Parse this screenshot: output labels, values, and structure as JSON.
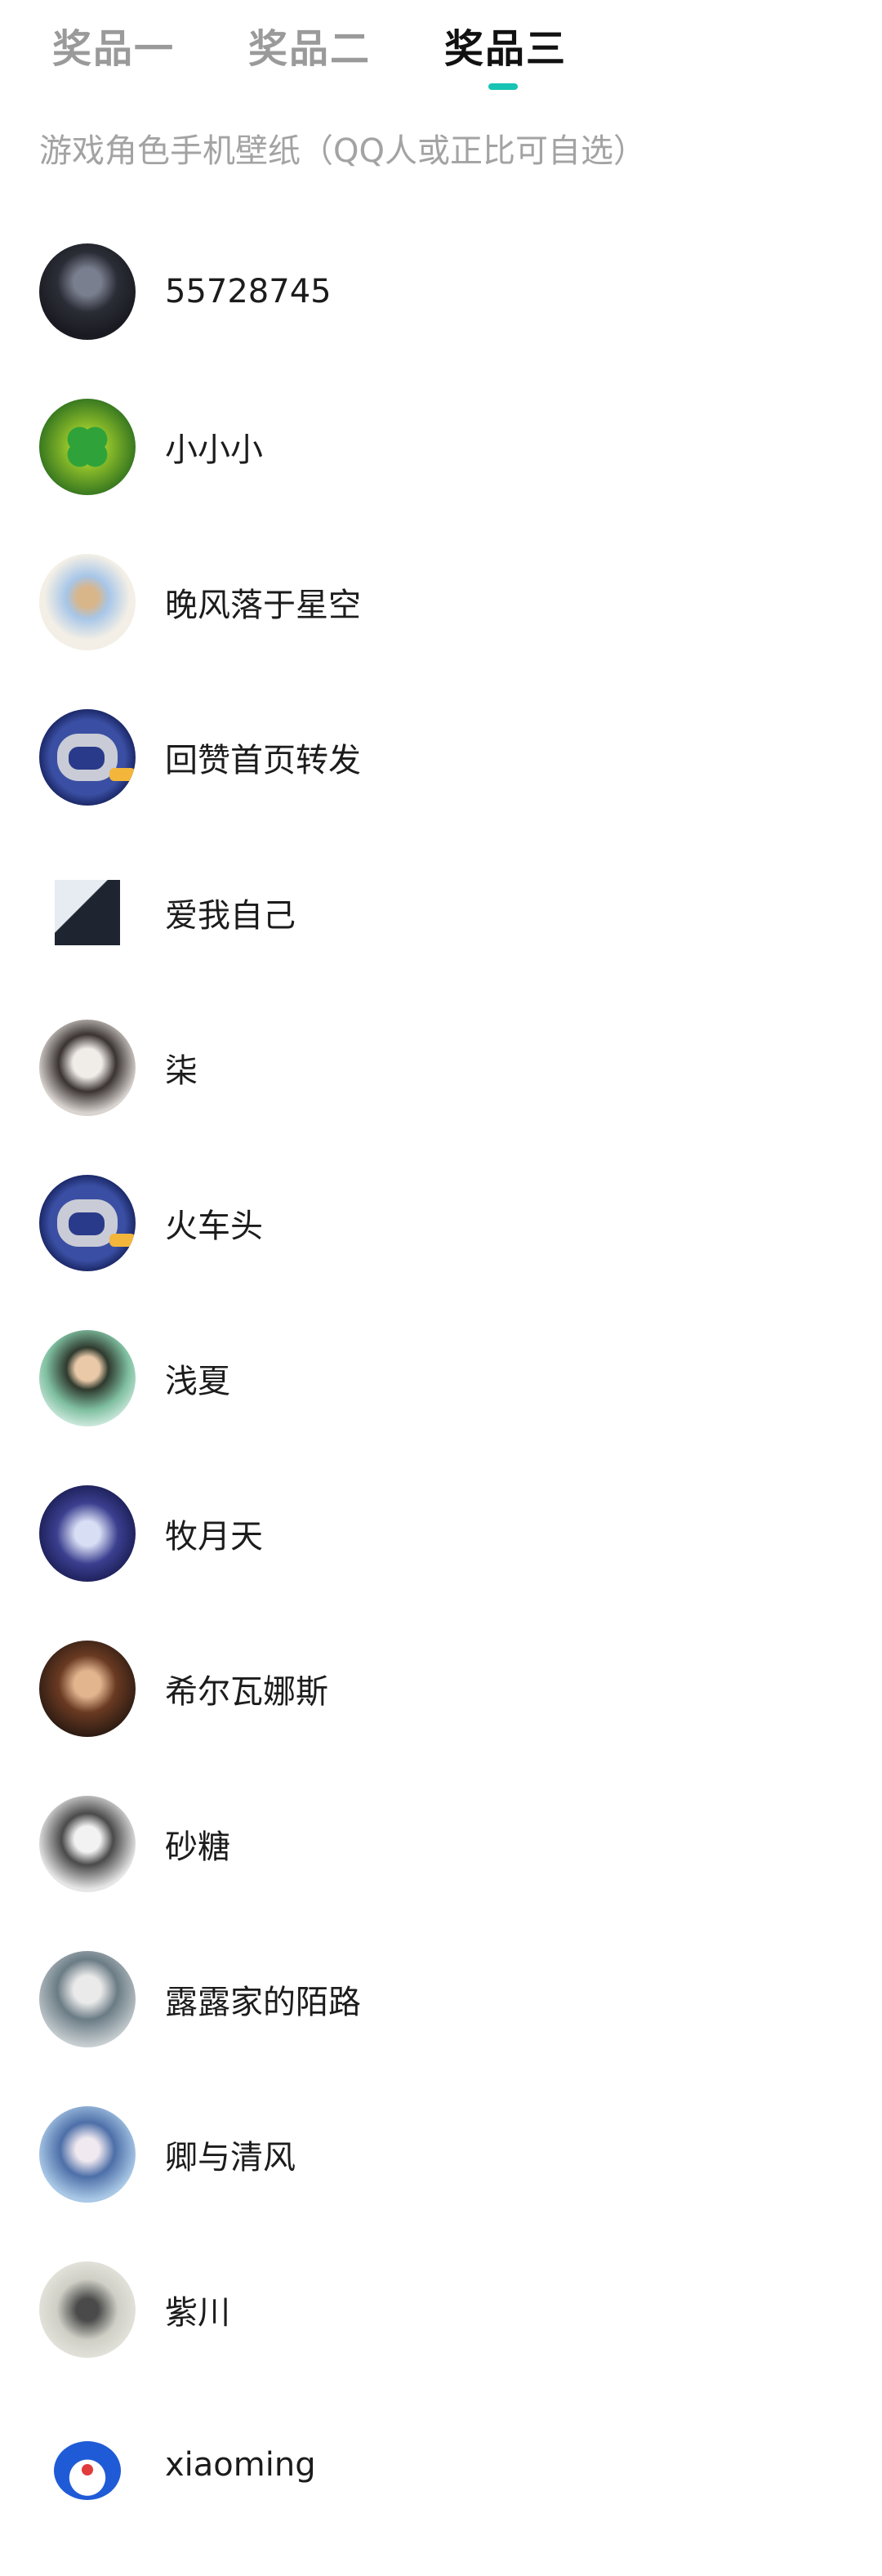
{
  "tabs": [
    {
      "label": "奖品一",
      "active": false
    },
    {
      "label": "奖品二",
      "active": false
    },
    {
      "label": "奖品三",
      "active": true
    }
  ],
  "accent_color": "#17c3b2",
  "subtitle": "游戏角色手机壁纸（QQ人或正比可自选）",
  "winners": [
    {
      "name": "55728745",
      "avatar": "anime-girl-avatar"
    },
    {
      "name": "小小小",
      "avatar": "clover-avatar"
    },
    {
      "name": "晚风落于星空",
      "avatar": "anime-boy-avatar"
    },
    {
      "name": "回赞首页转发",
      "avatar": "robot-avatar"
    },
    {
      "name": "爱我自己",
      "avatar": "photo-avatar"
    },
    {
      "name": "柒",
      "avatar": "girl-portrait-avatar"
    },
    {
      "name": "火车头",
      "avatar": "robot-avatar"
    },
    {
      "name": "浅夏",
      "avatar": "cartoon-boy-avatar"
    },
    {
      "name": "牧月天",
      "avatar": "anime-chibi-avatar"
    },
    {
      "name": "希尔瓦娜斯",
      "avatar": "warm-portrait-avatar"
    },
    {
      "name": "砂糖",
      "avatar": "girl-photo-avatar"
    },
    {
      "name": "露露家的陌路",
      "avatar": "anime-pale-avatar"
    },
    {
      "name": "卿与清风",
      "avatar": "anime-blue-avatar"
    },
    {
      "name": "紫川",
      "avatar": "ink-painting-avatar"
    },
    {
      "name": "xiaoming",
      "avatar": "doraemon-avatar"
    }
  ]
}
